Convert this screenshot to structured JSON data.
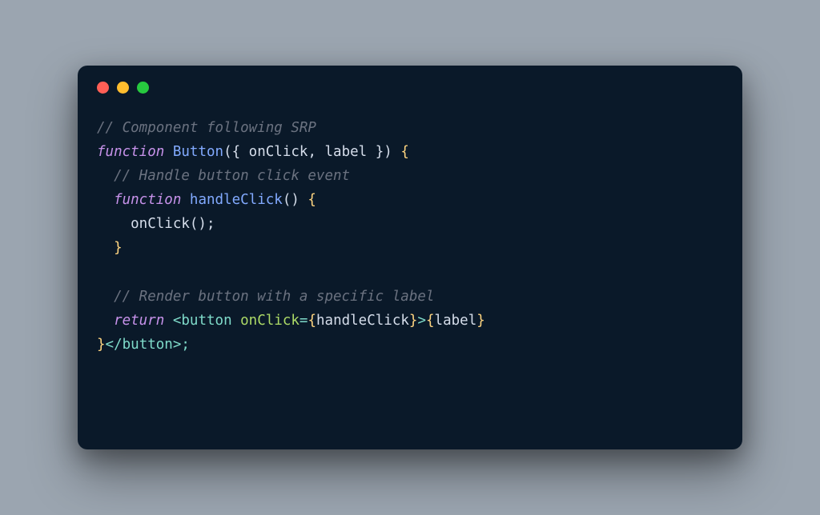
{
  "window": {
    "controls": {
      "close": "close",
      "minimize": "minimize",
      "maximize": "maximize"
    }
  },
  "code": {
    "line1_comment": "// Component following SRP",
    "line2_keyword_function": "function",
    "line2_name": "Button",
    "line2_params_open": "({ ",
    "line2_param1": "onClick",
    "line2_comma": ", ",
    "line2_param2": "label",
    "line2_params_close": " })",
    "line2_brace": " {",
    "line3_comment": "  // Handle button click event",
    "line4_indent": "  ",
    "line4_keyword_function": "function",
    "line4_name": " handleClick",
    "line4_parens": "()",
    "line4_brace": " {",
    "line5_text": "    onClick();",
    "line6_text": "  }",
    "line8_comment": "  // Render button with a specific label",
    "line9_indent": "  ",
    "line9_return": "return",
    "line9_space": " ",
    "line9_open_angle": "<",
    "line9_tag": "button",
    "line9_attr": " onClick",
    "line9_eq": "=",
    "line9_expr_open": "{",
    "line9_expr_val": "handleClick",
    "line9_expr_close": "}",
    "line9_close_angle": ">",
    "line9_label_open": "{",
    "line9_label": "label",
    "line9_label_close": "}",
    "line10_close_brace_outer": "}",
    "line10_close_angle": "</",
    "line10_tag": "button",
    "line10_end": ">;"
  }
}
